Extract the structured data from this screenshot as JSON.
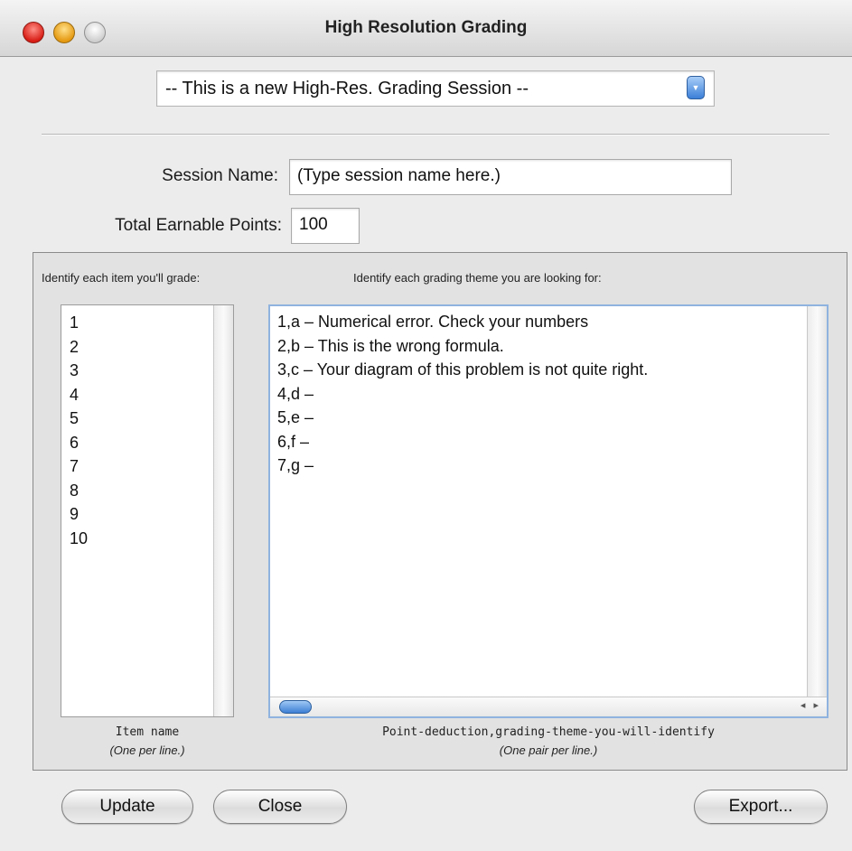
{
  "window": {
    "title": "High Resolution Grading"
  },
  "session_select": {
    "value": "-- This is a new High-Res. Grading Session --"
  },
  "form": {
    "session_name_label": "Session Name:",
    "session_name_value": "(Type session name here.)",
    "total_points_label": "Total Earnable Points:",
    "total_points_value": "100"
  },
  "items_section": {
    "heading": "Identify each item you'll grade:",
    "items": [
      "1",
      "2",
      "3",
      "4",
      "5",
      "6",
      "7",
      "8",
      "9",
      "10"
    ],
    "caption_main": "Item name",
    "caption_sub": "(One per line.)"
  },
  "themes_section": {
    "heading": "Identify each grading theme you are looking for:",
    "themes": [
      "1,a – Numerical error. Check your numbers",
      "2,b – This is the wrong formula.",
      "3,c – Your diagram of this problem is not quite right.",
      "4,d –",
      "5,e –",
      "6,f –",
      "7,g –"
    ],
    "caption_main": "Point-deduction,grading-theme-you-will-identify",
    "caption_sub": "(One pair per line.)"
  },
  "buttons": {
    "update": "Update",
    "close": "Close",
    "export": "Export..."
  }
}
